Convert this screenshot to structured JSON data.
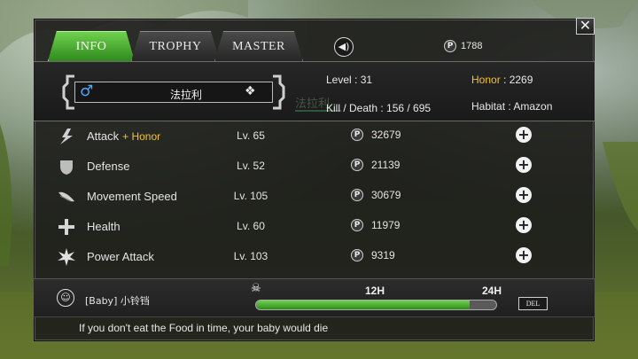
{
  "tabs": [
    {
      "label": "INFO",
      "active": true
    },
    {
      "label": "TROPHY",
      "active": false
    },
    {
      "label": "MASTER",
      "active": false
    }
  ],
  "header": {
    "sound_icon": "speaker-icon",
    "points_icon": "p-coin-icon",
    "points": "1788",
    "close_label": "✕"
  },
  "profile": {
    "gender_icon": "male-icon",
    "gender_symbol": "♂",
    "name": "法拉利",
    "level_label": "Level : 31",
    "kd_label": "Kill / Death : 156 / 695",
    "honor_label": "Honor",
    "honor_value": " : 2269",
    "habitat_label": "Habitat : Amazon",
    "ghost_name": "法拉利"
  },
  "stats": [
    {
      "name": "Attack",
      "bonus": "+ Honor",
      "level": "Lv. 65",
      "cost": "32679",
      "icon": "attack-icon"
    },
    {
      "name": "Defense",
      "bonus": "",
      "level": "Lv. 52",
      "cost": "21139",
      "icon": "shield-icon"
    },
    {
      "name": "Movement Speed",
      "bonus": "",
      "level": "Lv. 105",
      "cost": "30679",
      "icon": "wing-icon"
    },
    {
      "name": "Health",
      "bonus": "",
      "level": "Lv. 60",
      "cost": "11979",
      "icon": "cross-icon"
    },
    {
      "name": "Power Attack",
      "bonus": "",
      "level": "Lv. 103",
      "cost": "9319",
      "icon": "burst-icon"
    }
  ],
  "coin_symbol": "P",
  "plus_symbol": "+",
  "baby": {
    "icon": "baby-icon",
    "icon_symbol": "☺",
    "name": "[Baby]  小铃铛",
    "tick_12": "12H",
    "tick_24": "24H",
    "hunger_fraction": 0.89,
    "del_label": "DEL",
    "skull_symbol": "☠"
  },
  "hint": "If you don't eat the Food in time, your baby would die",
  "colors": {
    "accent_green": "#4caf2e",
    "honor_gold": "#f2c230",
    "male_blue": "#4aa8ff"
  }
}
